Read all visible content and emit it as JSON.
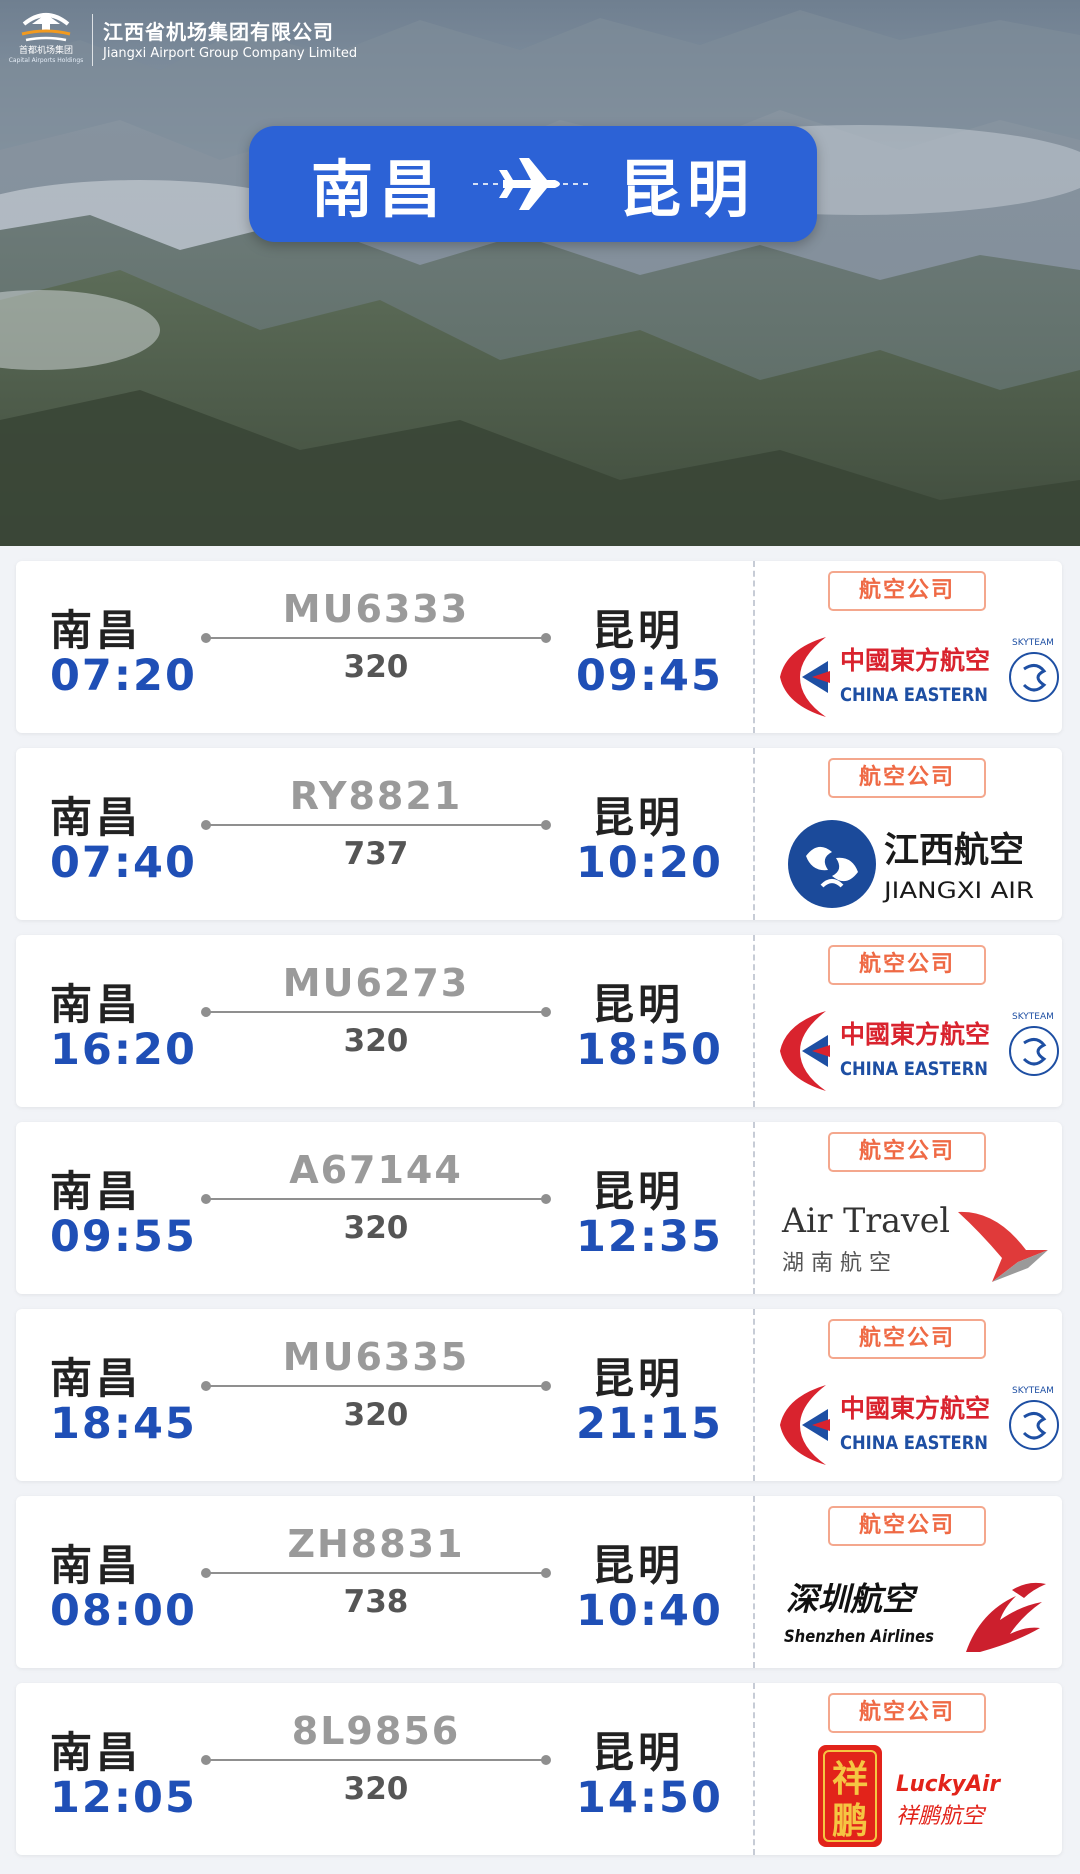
{
  "header": {
    "brand_cn": "江西省机场集团有限公司",
    "brand_en": "Jiangxi Airport Group Company Limited",
    "emblem_cn": "首都机场集团",
    "emblem_en": "Capital Airports Holdings"
  },
  "route": {
    "from": "南昌",
    "to": "昆明"
  },
  "airline_badge": "航空公司",
  "colors": {
    "accent_blue": "#2c62d6",
    "time_blue": "#1f4fb6",
    "badge_orange": "#ef6a45"
  },
  "flights": [
    {
      "dep_city": "南昌",
      "dep_time": "07:20",
      "flight_no": "MU6333",
      "aircraft": "320",
      "arr_city": "昆明",
      "arr_time": "09:45",
      "airline_logo": "china-eastern-logo",
      "airline_cn": "中國東方航空",
      "airline_en": "CHINA EASTERN",
      "alliance": "SKYTEAM"
    },
    {
      "dep_city": "南昌",
      "dep_time": "07:40",
      "flight_no": "RY8821",
      "aircraft": "737",
      "arr_city": "昆明",
      "arr_time": "10:20",
      "airline_logo": "jiangxi-air-logo",
      "airline_cn": "江西航空",
      "airline_en": "JIANGXI AIR"
    },
    {
      "dep_city": "南昌",
      "dep_time": "16:20",
      "flight_no": "MU6273",
      "aircraft": "320",
      "arr_city": "昆明",
      "arr_time": "18:50",
      "airline_logo": "china-eastern-logo",
      "airline_cn": "中國東方航空",
      "airline_en": "CHINA EASTERN",
      "alliance": "SKYTEAM"
    },
    {
      "dep_city": "南昌",
      "dep_time": "09:55",
      "flight_no": "A67144",
      "aircraft": "320",
      "arr_city": "昆明",
      "arr_time": "12:35",
      "airline_logo": "air-travel-logo",
      "airline_cn": "湖 南 航 空",
      "airline_en": "Air Travel"
    },
    {
      "dep_city": "南昌",
      "dep_time": "18:45",
      "flight_no": "MU6335",
      "aircraft": "320",
      "arr_city": "昆明",
      "arr_time": "21:15",
      "airline_logo": "china-eastern-logo",
      "airline_cn": "中國東方航空",
      "airline_en": "CHINA EASTERN",
      "alliance": "SKYTEAM"
    },
    {
      "dep_city": "南昌",
      "dep_time": "08:00",
      "flight_no": "ZH8831",
      "aircraft": "738",
      "arr_city": "昆明",
      "arr_time": "10:40",
      "airline_logo": "shenzhen-airlines-logo",
      "airline_cn": "深圳航空",
      "airline_en": "Shenzhen Airlines"
    },
    {
      "dep_city": "南昌",
      "dep_time": "12:05",
      "flight_no": "8L9856",
      "aircraft": "320",
      "arr_city": "昆明",
      "arr_time": "14:50",
      "airline_logo": "lucky-air-logo",
      "airline_cn": "祥鹏航空",
      "airline_en": "LuckyAir",
      "seal": "祥鹏"
    }
  ]
}
